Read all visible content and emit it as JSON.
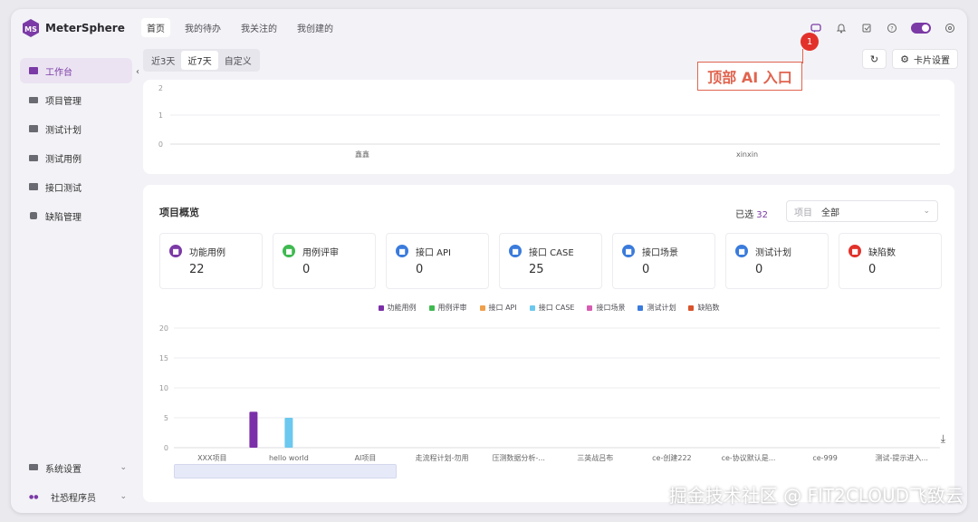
{
  "app": {
    "name": "MeterSphere",
    "brand_color": "#7b3aa6"
  },
  "topnav": {
    "items": [
      "首页",
      "我的待办",
      "我关注的",
      "我创建的"
    ],
    "active": 0
  },
  "top_icons": [
    "ai-chat-icon",
    "bell-icon",
    "task-icon",
    "help-icon",
    "theme-toggle-icon",
    "settings-icon"
  ],
  "sidebar": {
    "items": [
      {
        "label": "工作台",
        "icon": "dashboard-icon",
        "active": true
      },
      {
        "label": "项目管理",
        "icon": "folder-icon"
      },
      {
        "label": "测试计划",
        "icon": "plan-icon"
      },
      {
        "label": "测试用例",
        "icon": "case-icon"
      },
      {
        "label": "接口测试",
        "icon": "api-icon"
      },
      {
        "label": "缺陷管理",
        "icon": "bug-icon"
      }
    ],
    "bottom": {
      "settings": "系统设置",
      "user": "社恐程序员"
    }
  },
  "range": {
    "options": [
      "近3天",
      "近7天",
      "自定义"
    ],
    "active": 1
  },
  "toolbar": {
    "refresh": "refresh-icon",
    "card_settings": "卡片设置"
  },
  "top_chart": {
    "y_ticks": [
      "2",
      "1",
      "0"
    ],
    "x_labels": [
      "鑫鑫",
      "xinxin"
    ]
  },
  "overview": {
    "title": "项目概览",
    "selected_prefix": "已选",
    "selected_count": "32",
    "select_label": "项目",
    "select_value": "全部",
    "stats": [
      {
        "name": "功能用例",
        "value": "22",
        "color": "#7b3aa6"
      },
      {
        "name": "用例评审",
        "value": "0",
        "color": "#3fb950"
      },
      {
        "name": "接口 API",
        "value": "0",
        "color": "#3a7bdc"
      },
      {
        "name": "接口 CASE",
        "value": "25",
        "color": "#3a7bdc"
      },
      {
        "name": "接口场景",
        "value": "0",
        "color": "#3a7bdc"
      },
      {
        "name": "测试计划",
        "value": "0",
        "color": "#3a7bdc"
      },
      {
        "name": "缺陷数",
        "value": "0",
        "color": "#e2312a"
      }
    ]
  },
  "chart_data": {
    "type": "bar",
    "categories": [
      "XXX项目",
      "hello world",
      "AI项目",
      "走流程计划-勿用",
      "压测数据分析-...",
      "三英战吕布",
      "ce-创建222",
      "ce-协议默认是...",
      "ce-999",
      "测试-提示进入..."
    ],
    "series": [
      {
        "name": "功能用例",
        "color": "#7b2fa8",
        "values": [
          0,
          6,
          0,
          0,
          0,
          0,
          0,
          0,
          0,
          0
        ]
      },
      {
        "name": "用例评审",
        "color": "#3fb950",
        "values": [
          0,
          0,
          0,
          0,
          0,
          0,
          0,
          0,
          0,
          0
        ]
      },
      {
        "name": "接口 API",
        "color": "#f0a04b",
        "values": [
          0,
          0,
          0,
          0,
          0,
          0,
          0,
          0,
          0,
          0
        ]
      },
      {
        "name": "接口 CASE",
        "color": "#6cc8ee",
        "values": [
          0,
          5,
          0,
          0,
          0,
          0,
          0,
          0,
          0,
          0
        ]
      },
      {
        "name": "接口场景",
        "color": "#d65db1",
        "values": [
          0,
          0,
          0,
          0,
          0,
          0,
          0,
          0,
          0,
          0
        ]
      },
      {
        "name": "测试计划",
        "color": "#3a7bdc",
        "values": [
          0,
          0,
          0,
          0,
          0,
          0,
          0,
          0,
          0,
          0
        ]
      },
      {
        "name": "缺陷数",
        "color": "#d9532c",
        "values": [
          0,
          0,
          0,
          0,
          0,
          0,
          0,
          0,
          0,
          0
        ]
      }
    ],
    "y_ticks": [
      0,
      5,
      10,
      15,
      20
    ],
    "ylim": [
      0,
      20
    ],
    "grid": true,
    "legend": "top-center"
  },
  "annotation": {
    "callout": "顶部 AI 入口",
    "badge": "1"
  },
  "watermark": "掘金技术社区 @ FIT2CLOUD飞致云"
}
